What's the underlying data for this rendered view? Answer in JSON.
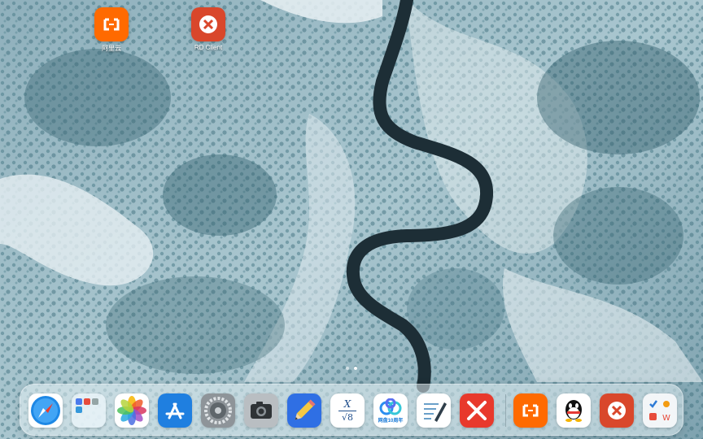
{
  "home_icons": [
    {
      "label": "阿里云",
      "icon": "aliyun-icon",
      "color": "#ff6a00"
    },
    {
      "label": "RD Client",
      "icon": "rd-client-icon",
      "color": "#d9472b"
    }
  ],
  "page_indicator": {
    "count": 2,
    "current": 2
  },
  "dock": {
    "apps": [
      {
        "name": "Safari",
        "icon": "safari-icon"
      },
      {
        "name": "Files Folder",
        "icon": "folder-icon"
      },
      {
        "name": "Photos",
        "icon": "photos-icon"
      },
      {
        "name": "App Store",
        "icon": "app-store-icon"
      },
      {
        "name": "Settings",
        "icon": "settings-icon"
      },
      {
        "name": "Camera",
        "icon": "camera-icon"
      },
      {
        "name": "Pencil App",
        "icon": "pencil-icon"
      },
      {
        "name": "Math App",
        "icon": "math-icon",
        "glyph_top": "X",
        "glyph_bottom": "√8"
      },
      {
        "name": "Baidu Netdisk",
        "icon": "baidu-netdisk-icon",
        "badge_text": "网盘10周年"
      },
      {
        "name": "Notes",
        "icon": "notes-icon"
      },
      {
        "name": "Office X",
        "icon": "office-x-icon"
      }
    ],
    "recent_apps": [
      {
        "name": "阿里云",
        "icon": "aliyun-icon"
      },
      {
        "name": "QQ",
        "icon": "qq-icon"
      },
      {
        "name": "RD Client",
        "icon": "rd-client-icon"
      },
      {
        "name": "App Folder",
        "icon": "app-folder-icon"
      }
    ]
  },
  "colors": {
    "aliyun": "#ff6a00",
    "rd_client": "#d9472b",
    "office_x": "#e8392c",
    "app_store": "#1f7fe0",
    "river": "#1d2e36"
  }
}
